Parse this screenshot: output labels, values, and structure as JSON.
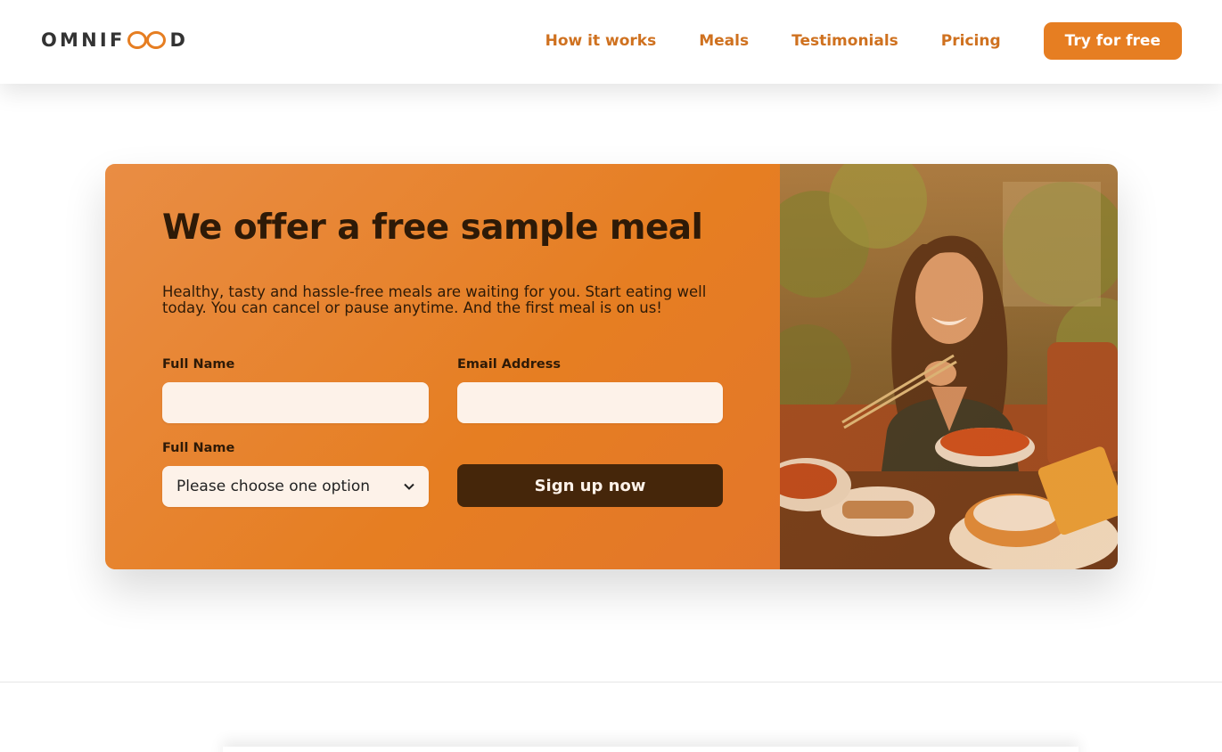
{
  "header": {
    "logo_text_left": "OMNIF",
    "logo_text_right": "D",
    "nav": [
      {
        "label": "How it works"
      },
      {
        "label": "Meals"
      },
      {
        "label": "Testimonials"
      },
      {
        "label": "Pricing"
      }
    ],
    "cta_label": "Try for free"
  },
  "cta_section": {
    "title": "We offer a free sample meal",
    "description": "Healthy, tasty and hassle-free meals are waiting for you. Start eating well today. You can cancel or pause anytime. And the first meal is on us!",
    "form": {
      "full_name_label": "Full Name",
      "email_label": "Email Address",
      "select_label": "Full Name",
      "select_value": "Please choose one option",
      "submit_label": "Sign up now"
    }
  },
  "colors": {
    "brand": "#e67e22",
    "brand_dark": "#cf711f",
    "text_dark": "#2e1a07",
    "button_dark": "#45260a",
    "input_bg": "#fdf2e9"
  },
  "icons": [
    "infinity-logo-icon",
    "chevron-down-icon"
  ]
}
